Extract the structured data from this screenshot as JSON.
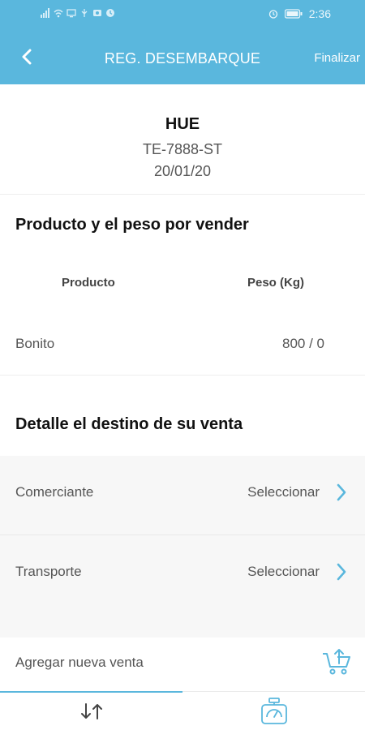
{
  "status_bar": {
    "time": "2:36"
  },
  "appbar": {
    "title": "REG. DESEMBARQUE",
    "action_label": "Finalizar"
  },
  "summary": {
    "code": "HUE",
    "plate": "TE-7888-ST",
    "date": "20/01/20"
  },
  "product_section": {
    "title": "Producto y el peso por vender",
    "columns": [
      "Producto",
      "Peso (Kg)"
    ],
    "rows": [
      {
        "product": "Bonito",
        "weight": "800 / 0"
      }
    ]
  },
  "destination_section": {
    "title": "Detalle el destino de su venta",
    "rows": [
      {
        "label": "Comerciante",
        "value": "Seleccionar"
      },
      {
        "label": "Transporte",
        "value": "Seleccionar"
      }
    ]
  },
  "add_sale": {
    "label": "Agregar nueva venta",
    "icon": "cart-upload-icon"
  },
  "tabs": [
    {
      "icon": "transfer-arrows-icon",
      "active": true
    },
    {
      "icon": "scale-icon",
      "active": false
    }
  ],
  "colors": {
    "primary": "#5ab7dd",
    "text_muted": "#555555"
  }
}
